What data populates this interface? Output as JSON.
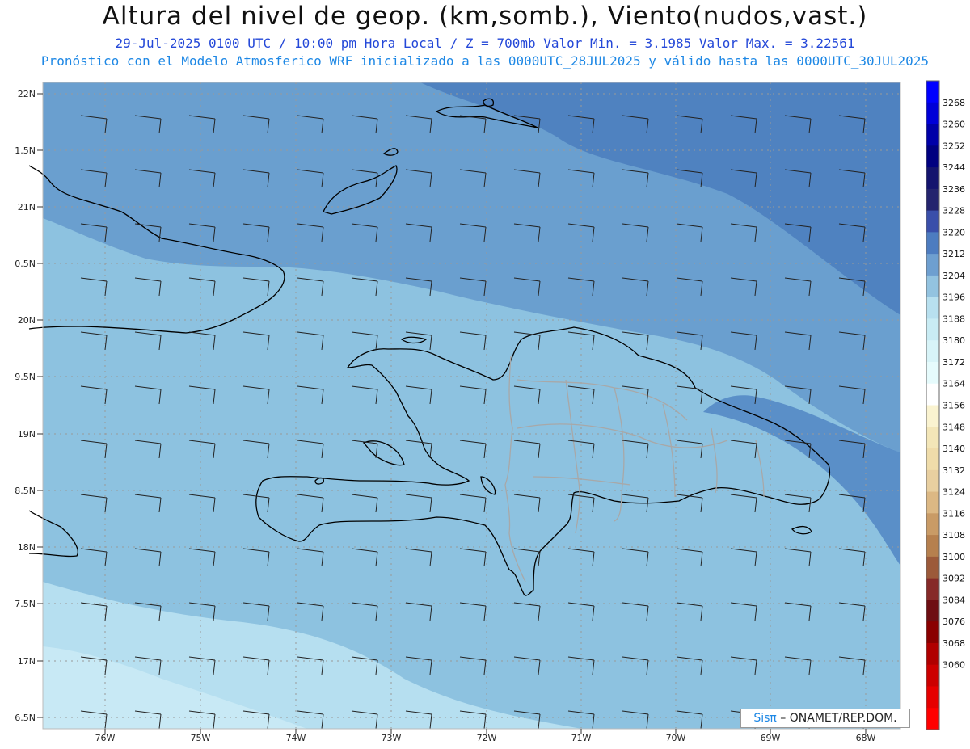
{
  "header": {
    "title": "Altura del nivel de geop. (km,somb.), Viento(nudos,vast.)",
    "line1": "29-Jul-2025  0100 UTC / 10:00 pm Hora Local / Z = 700mb    Valor Min. = 3.1985  Valor Max. = 3.22561",
    "line2": "Pronóstico con el Modelo Atmosferico WRF inicializado a las 0000UTC_28JUL2025 y válido hasta las  0000UTC_30JUL2025"
  },
  "axes": {
    "lat_labels": [
      "22N",
      "1.5N",
      "21N",
      "0.5N",
      "20N",
      "9.5N",
      "19N",
      "8.5N",
      "18N",
      "7.5N",
      "17N",
      "6.5N"
    ],
    "lon_labels": [
      "76W",
      "75W",
      "74W",
      "73W",
      "72W",
      "71W",
      "70W",
      "69W",
      "68W"
    ]
  },
  "colorbar": {
    "labels": [
      "3268",
      "3260",
      "3252",
      "3244",
      "3236",
      "3228",
      "3220",
      "3212",
      "3204",
      "3196",
      "3188",
      "3180",
      "3172",
      "3164",
      "3156",
      "3148",
      "3140",
      "3132",
      "3124",
      "3116",
      "3108",
      "3100",
      "3092",
      "3084",
      "3076",
      "3068",
      "3060"
    ],
    "colors": [
      "#0000ff",
      "#0000d8",
      "#0000a8",
      "#000080",
      "#14146e",
      "#24246e",
      "#3a4faa",
      "#4d7cc0",
      "#6e9fd0",
      "#93c3e0",
      "#b8e0ef",
      "#c9ecf4",
      "#d8f4f8",
      "#e6fbfc",
      "#ffffff",
      "#faf3d0",
      "#f3e6b8",
      "#efdcaa",
      "#e8cfa0",
      "#dcb884",
      "#c99b66",
      "#b6804e",
      "#9c5a3a",
      "#862a28",
      "#6e0e12",
      "#8a0000",
      "#b00000",
      "#cc0000",
      "#e60000",
      "#ff0000"
    ]
  },
  "map": {
    "fill_colors": {
      "dark": "#4f82c0",
      "mid": "#6a9fcf",
      "light": "#8dc2e0",
      "lighter": "#b6dff0",
      "pale": "#c8e9f5"
    }
  },
  "credit": {
    "sis": "Sisπ",
    "rest": " – ONAMET/REP.DOM."
  }
}
